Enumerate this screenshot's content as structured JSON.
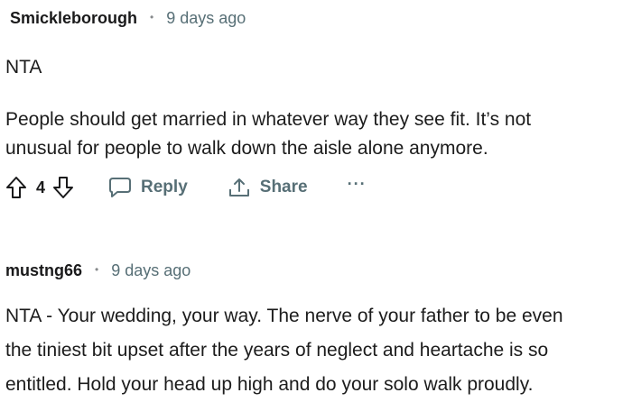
{
  "comments": [
    {
      "author": "Smickleborough",
      "separator": "•",
      "time": "9 days ago",
      "paragraphs": [
        "NTA",
        "People should get married in whatever way they see fit. It’s not\nunusual for people to walk down the aisle alone anymore."
      ],
      "vote_count": "4",
      "actions": {
        "reply": "Reply",
        "share": "Share",
        "more": "···"
      }
    },
    {
      "author": "mustng66",
      "separator": "•",
      "time": "9 days ago",
      "paragraphs": [
        "NTA - Your wedding, your way. The nerve of your father to be even\nthe tiniest bit upset after the years of neglect and heartache is so\nentitled. Hold your head up high and do your solo walk proudly."
      ]
    }
  ],
  "icons": {
    "upvote": "upvote-arrow-icon",
    "downvote": "downvote-arrow-icon",
    "reply": "speech-bubble-icon",
    "share": "share-upload-icon",
    "more": "ellipsis-icon"
  }
}
